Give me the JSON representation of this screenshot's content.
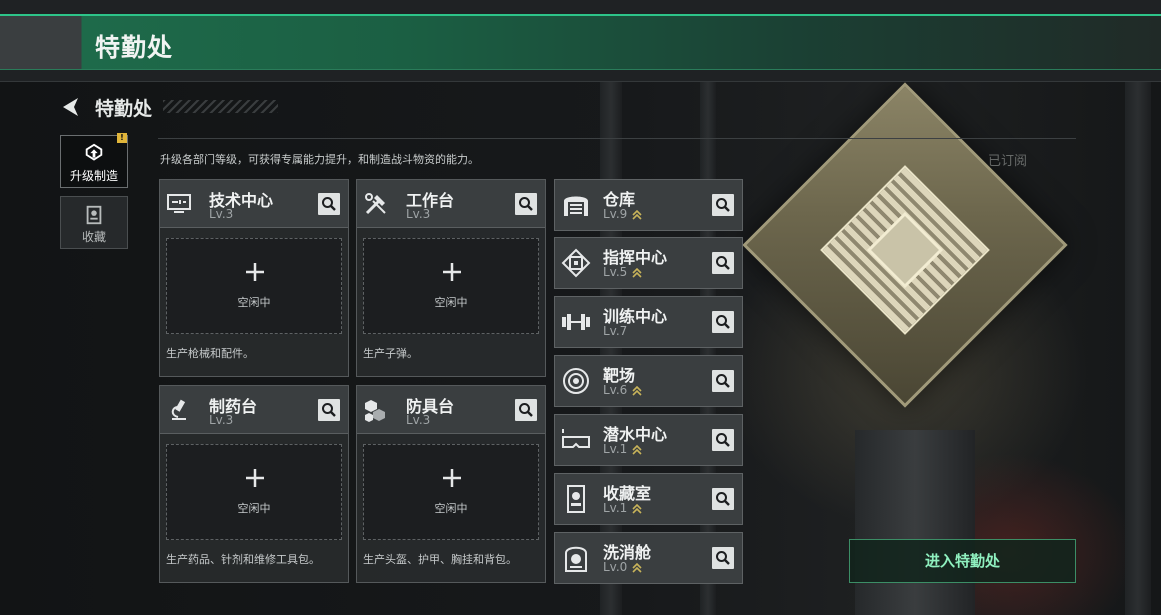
{
  "header": {
    "title": "特勤处"
  },
  "breadcrumb": {
    "title": "特勤处"
  },
  "side_tabs": [
    {
      "label": "升级制造",
      "icon": "upgrade-icon",
      "active": true,
      "alert": "!"
    },
    {
      "label": "收藏",
      "icon": "collection-icon",
      "active": false
    }
  ],
  "panel": {
    "subtitle": "升级各部门等级，可获得专属能力提升，和制造战斗物资的能力。",
    "subscribed_label": "已订阅"
  },
  "production_cards": [
    {
      "name": "技术中心",
      "level": "Lv.3",
      "icon": "tech-center-icon",
      "slot_status": "空闲中",
      "desc": "生产枪械和配件。"
    },
    {
      "name": "工作台",
      "level": "Lv.3",
      "icon": "workbench-icon",
      "slot_status": "空闲中",
      "desc": "生产子弹。"
    },
    {
      "name": "制药台",
      "level": "Lv.3",
      "icon": "pharmacy-icon",
      "slot_status": "空闲中",
      "desc": "生产药品、针剂和维修工具包。"
    },
    {
      "name": "防具台",
      "level": "Lv.3",
      "icon": "armor-bench-icon",
      "slot_status": "空闲中",
      "desc": "生产头盔、护甲、胸挂和背包。"
    }
  ],
  "departments": [
    {
      "name": "仓库",
      "level": "Lv.9",
      "icon": "warehouse-icon",
      "upgradable": true
    },
    {
      "name": "指挥中心",
      "level": "Lv.5",
      "icon": "command-center-icon",
      "upgradable": true
    },
    {
      "name": "训练中心",
      "level": "Lv.7",
      "icon": "training-center-icon",
      "upgradable": false
    },
    {
      "name": "靶场",
      "level": "Lv.6",
      "icon": "shooting-range-icon",
      "upgradable": true
    },
    {
      "name": "潜水中心",
      "level": "Lv.1",
      "icon": "diving-center-icon",
      "upgradable": true
    },
    {
      "name": "收藏室",
      "level": "Lv.1",
      "icon": "collection-room-icon",
      "upgradable": true
    },
    {
      "name": "洗消舱",
      "level": "Lv.0",
      "icon": "decontamination-icon",
      "upgradable": true
    }
  ],
  "enter_button": {
    "label": "进入特勤处"
  },
  "colors": {
    "accent": "#2dc489",
    "button_text": "#8ff0bf",
    "upgrade_arrow": "#c9b45a"
  }
}
